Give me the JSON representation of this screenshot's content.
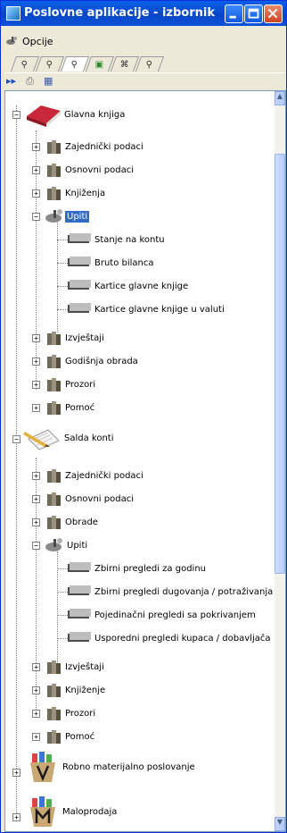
{
  "window": {
    "title": "Poslovne aplikacije - izbornik",
    "controls": [
      "minimize",
      "maximize",
      "close"
    ],
    "accent": "#0a52d8"
  },
  "menu": {
    "items": [
      {
        "label": "Opcije",
        "icon": "satellite-icon"
      }
    ]
  },
  "tabs": [
    {
      "icon": "satellite-icon"
    },
    {
      "icon": "satellite-icon"
    },
    {
      "icon": "satellite-icon"
    },
    {
      "icon": "form-icon"
    },
    {
      "icon": "binoculars-icon"
    },
    {
      "icon": "satellite-icon"
    }
  ],
  "toolbar": [
    {
      "icon": "fast-forward-icon"
    },
    {
      "icon": "printer-icon"
    },
    {
      "icon": "grid-icon"
    }
  ],
  "tree": {
    "root_1": "Glavna knjiga",
    "g1_1": "Zajednički podaci",
    "g1_2": "Osnovni podaci",
    "g1_3": "Knjiženja",
    "g1_4": "Upiti",
    "g1_4_1": "Stanje na kontu",
    "g1_4_2": "Bruto bilanca",
    "g1_4_3": "Kartice glavne knjige",
    "g1_4_4": "Kartice glavne knjige u valuti",
    "g1_5": "Izvještaji",
    "g1_6": "Godišnja obrada",
    "g1_7": "Prozori",
    "g1_8": "Pomoć",
    "root_2": "Salda konti",
    "g2_1": "Zajednički podaci",
    "g2_2": "Osnovni podaci",
    "g2_3": "Obrade",
    "g2_4": "Upiti",
    "g2_4_1": "Zbirni pregledi za godinu",
    "g2_4_2": "Zbirni pregledi dugovanja / potraživanja",
    "g2_4_3": "Pojedinačni pregledi sa pokrivanjem",
    "g2_4_4": "Usporedni pregledi kupaca / dobavljača",
    "g2_5": "Izvještaji",
    "g2_6": "Knjiženje",
    "g2_7": "Prozori",
    "g2_8": "Pomoć",
    "root_3": "Robno materijalno poslovanje",
    "root_4": "Maloprodaja",
    "selected": "Upiti"
  }
}
